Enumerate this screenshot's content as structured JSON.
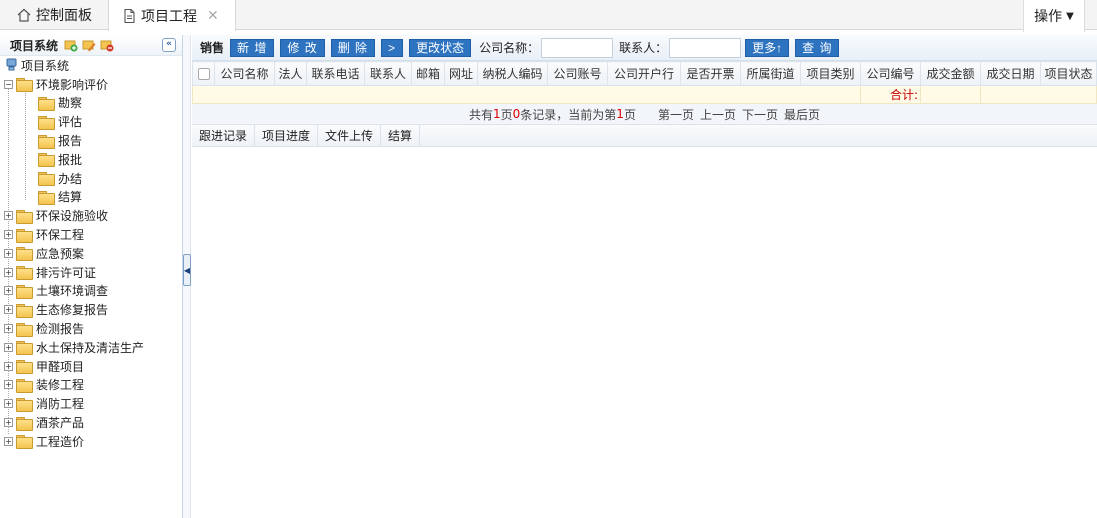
{
  "top_tabs": [
    {
      "label": "控制面板",
      "icon": "home-icon"
    },
    {
      "label": "项目工程",
      "icon": "document-icon",
      "close": "✕"
    }
  ],
  "operations_menu": {
    "label": "操作"
  },
  "left_panel": {
    "title": "项目系统",
    "collapse_glyph": "«",
    "tree": {
      "root": "项目系统",
      "groups": [
        {
          "label": "环境影响评价",
          "expanded": true,
          "children": [
            "勘察",
            "评估",
            "报告",
            "报批",
            "办结",
            "结算"
          ]
        },
        {
          "label": "环保设施验收"
        },
        {
          "label": "环保工程"
        },
        {
          "label": "应急预案"
        },
        {
          "label": "排污许可证"
        },
        {
          "label": "土壤环境调查"
        },
        {
          "label": "生态修复报告"
        },
        {
          "label": "检测报告"
        },
        {
          "label": "水土保持及清洁生产"
        },
        {
          "label": "甲醛项目"
        },
        {
          "label": "装修工程"
        },
        {
          "label": "消防工程"
        },
        {
          "label": "酒茶产品"
        },
        {
          "label": "工程造价"
        }
      ]
    }
  },
  "toolbar": {
    "title": "销售",
    "add": "新 增",
    "edit": "修 改",
    "delete": "删 除",
    "next": ">",
    "change_status": "更改状态",
    "company_label": "公司名称：",
    "company_value": "",
    "contact_label": "联系人：",
    "contact_value": "",
    "more": "更多↑",
    "query": "查 询"
  },
  "table": {
    "columns": [
      "公司名称",
      "法人",
      "联系电话",
      "联系人",
      "邮箱",
      "网址",
      "纳税人编码",
      "公司账号",
      "公司开户行",
      "是否开票",
      "所属街道",
      "项目类别",
      "公司编号",
      "成交金额",
      "成交日期",
      "项目状态"
    ],
    "sum_label": "合计:"
  },
  "pager": {
    "p1": "共有",
    "total_pages": "1",
    "p2": "页",
    "total_records": "0",
    "p3": "条记录，当前为第",
    "current": "1",
    "p4": "页",
    "first": "第一页",
    "prev": "上一页",
    "next": "下一页",
    "last": "最后页"
  },
  "sub_tabs": [
    "跟进记录",
    "项目进度",
    "文件上传",
    "结算"
  ],
  "colors": {
    "accent": "#2d73bf",
    "sum_text": "#c40000",
    "sum_row": "#fffbe7"
  }
}
